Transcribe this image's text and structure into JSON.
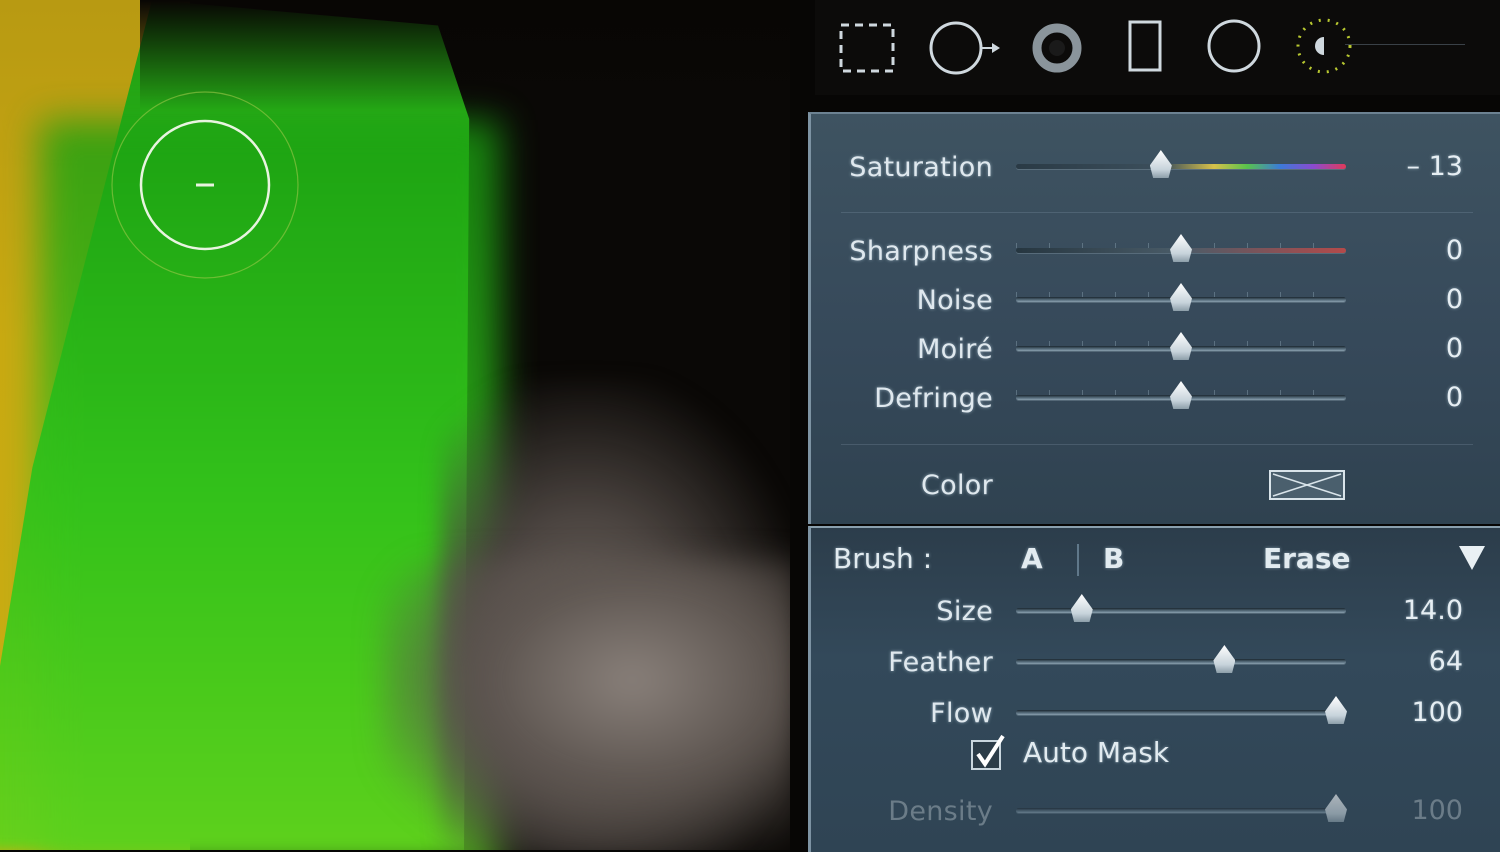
{
  "toolbar": {
    "tools": [
      {
        "icon": "crop-overlay-icon"
      },
      {
        "icon": "spot-removal-icon"
      },
      {
        "icon": "red-eye-icon"
      },
      {
        "icon": "graduated-filter-icon"
      },
      {
        "icon": "radial-filter-icon"
      },
      {
        "icon": "adjustment-brush-icon"
      }
    ]
  },
  "effects": {
    "saturation": {
      "label": "Saturation",
      "value": "– 13",
      "level": -13
    },
    "sharpness": {
      "label": "Sharpness",
      "value": "0",
      "level": 0
    },
    "noise": {
      "label": "Noise",
      "value": "0",
      "level": 0
    },
    "moire": {
      "label": "Moiré",
      "value": "0",
      "level": 0
    },
    "defringe": {
      "label": "Defringe",
      "value": "0",
      "level": 0
    },
    "color": {
      "label": "Color"
    }
  },
  "brush": {
    "title": "Brush :",
    "tab_a": "A",
    "tab_b": "B",
    "tab_erase": "Erase",
    "size": {
      "label": "Size",
      "value": "14.0",
      "fraction": 0.18
    },
    "feather": {
      "label": "Feather",
      "value": "64",
      "fraction": 0.64
    },
    "flow": {
      "label": "Flow",
      "value": "100",
      "fraction": 1.0
    },
    "auto_mask": {
      "label": "Auto Mask",
      "checked": true
    },
    "density": {
      "label": "Density",
      "value": "100",
      "fraction": 1.0
    }
  },
  "colors": {
    "panel": "#3a4f5e",
    "text": "#dfe8ee",
    "photo_green": "#3ac21a",
    "photo_yellow": "#c9a912"
  }
}
